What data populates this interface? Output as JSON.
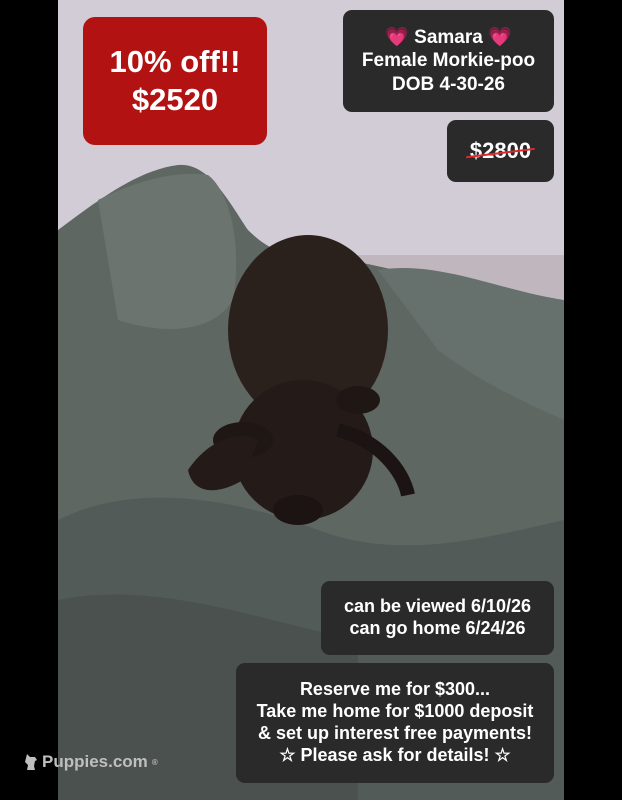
{
  "discount": {
    "line1": "10% off!!",
    "line2": "$2520"
  },
  "puppy": {
    "heart_left": "💗",
    "name": "Samara",
    "heart_right": "💗",
    "description": "Female Morkie-poo",
    "dob": "DOB 4-30-26"
  },
  "original_price": "$2800",
  "dates": {
    "viewing": "can be viewed 6/10/26",
    "go_home": "can go home 6/24/26"
  },
  "reserve": {
    "line1": "Reserve me for $300...",
    "line2": "Take me home for $1000 deposit",
    "line3": "& set up interest free payments!",
    "line4": "☆ Please ask for details! ☆"
  },
  "watermark": {
    "text": "Puppies.com",
    "reg": "®",
    "icon": "dog-silhouette-icon"
  },
  "colors": {
    "discount_bg": "#b31212",
    "box_bg": "#2a2a2a",
    "blanket": "#5b6360",
    "puppy": "#2a201c"
  }
}
